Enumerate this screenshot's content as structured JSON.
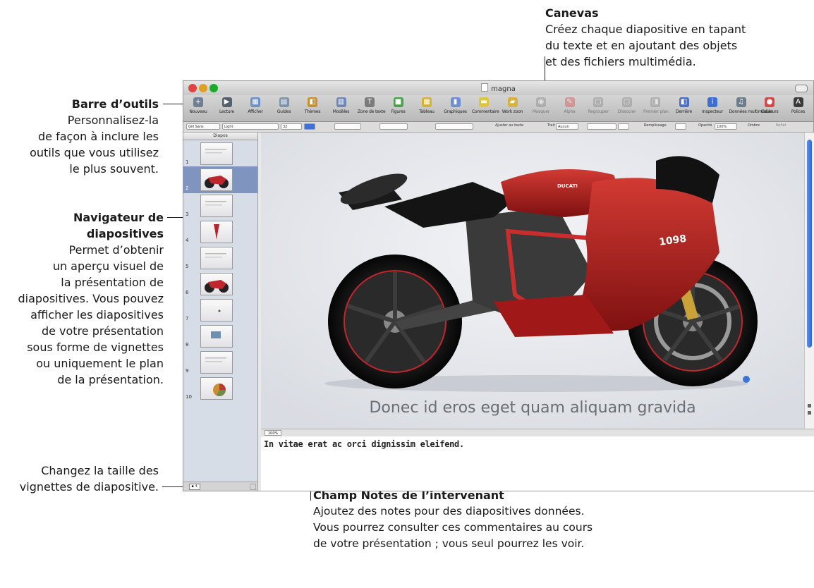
{
  "callouts": {
    "canvas": {
      "title": "Canevas",
      "lines": [
        "Créez chaque diapositive en tapant",
        "du texte et en ajoutant des objets",
        "et des fichiers multimédia."
      ]
    },
    "toolbar": {
      "title": "Barre d’outils",
      "lines": [
        "Personnalisez-la",
        "de façon à inclure les",
        "outils que vous utilisez",
        "le plus souvent."
      ]
    },
    "navigator": {
      "title_lines": [
        "Navigateur de",
        "diapositives"
      ],
      "lines": [
        "Permet d’obtenir",
        "un aperçu visuel de",
        "la présentation de",
        "diapositives. Vous pouvez",
        "afficher les diapositives",
        "de votre présentation",
        "sous forme de vignettes",
        "ou uniquement le plan",
        "de la présentation."
      ]
    },
    "thumb_size": {
      "lines": [
        "Changez la taille des",
        "vignettes de diapositive."
      ]
    },
    "notes": {
      "title": "Champ Notes de l’intervenant",
      "lines": [
        "Ajoutez des notes pour des diapositives données.",
        "Vous pourrez consulter ces commentaires au cours",
        "de votre présentation ; vous seul pourrez les voir."
      ]
    }
  },
  "window": {
    "title": "magna",
    "traffic_colors": [
      "#e0443e",
      "#dea123",
      "#1aab29"
    ]
  },
  "toolbar": [
    {
      "label": "Nouveau",
      "icon": "plus-icon",
      "glyph": "+",
      "color": "#6f7f93"
    },
    {
      "label": "Lecture",
      "icon": "play-icon",
      "glyph": "▶",
      "color": "#55606e"
    },
    {
      "label": "Afficher",
      "icon": "view-icon",
      "glyph": "▦",
      "color": "#6b8fc7"
    },
    {
      "label": "Guides",
      "icon": "guides-icon",
      "glyph": "▤",
      "color": "#7d93ad"
    },
    {
      "label": "Thèmes",
      "icon": "themes-icon",
      "glyph": "◧",
      "color": "#c98f31"
    },
    {
      "label": "Modèles",
      "icon": "masters-icon",
      "glyph": "▥",
      "color": "#6f86b5"
    },
    {
      "label": "Zone de texte",
      "icon": "textbox-icon",
      "glyph": "T",
      "color": "#7b7b7b"
    },
    {
      "label": "Figures",
      "icon": "shapes-icon",
      "glyph": "■",
      "color": "#4aa34a"
    },
    {
      "label": "Tableau",
      "icon": "table-icon",
      "glyph": "▦",
      "color": "#d6b234"
    },
    {
      "label": "Graphiques",
      "icon": "charts-icon",
      "glyph": "▮",
      "color": "#6d8fd6"
    },
    {
      "label": "Commentaire",
      "icon": "comment-icon",
      "glyph": "▬",
      "color": "#e2c53e"
    },
    {
      "label": "Work zoon",
      "icon": "folder-icon",
      "glyph": "▰",
      "color": "#d8b13f"
    },
    {
      "label": "Masquer",
      "icon": "mask-icon",
      "glyph": "◉",
      "color": "#8a8a8a"
    },
    {
      "label": "Alpha",
      "icon": "alpha-icon",
      "glyph": "✎",
      "color": "#d95555"
    },
    {
      "label": "Regrouper",
      "icon": "group-icon",
      "glyph": "▢",
      "color": "#8a8a8a"
    },
    {
      "label": "Dissocier",
      "icon": "ungroup-icon",
      "glyph": "▢",
      "color": "#8a8a8a"
    },
    {
      "label": "Premier plan",
      "icon": "front-icon",
      "glyph": "◨",
      "color": "#8a8a8a"
    },
    {
      "label": "Derrière",
      "icon": "back-icon",
      "glyph": "◧",
      "color": "#4b6fc2"
    },
    {
      "label": "Inspecteur",
      "icon": "inspector-icon",
      "glyph": "i",
      "color": "#3b6fd4"
    },
    {
      "label": "Données multimédias",
      "icon": "media-icon",
      "glyph": "♫",
      "color": "#6d7c8c"
    },
    {
      "label": "Couleurs",
      "icon": "colors-icon",
      "glyph": "●",
      "color": "#d44848"
    },
    {
      "label": "Polices",
      "icon": "fonts-icon",
      "glyph": "A",
      "color": "#3a3a3a"
    }
  ],
  "formatbar": {
    "font_family": "Gill Sans",
    "font_style": "Light",
    "font_size": "32",
    "autosize": "Ajuster au texte",
    "trait_label": "Trait",
    "trait_value": "Aucun",
    "fill_label": "Remplissage",
    "opacity_label": "Opacité",
    "opacity_value": "100%",
    "shadow_label": "Ombre",
    "reflection_label": "Reflet"
  },
  "navigator": {
    "header": "Diapos",
    "slides": [
      {
        "number": "1",
        "selected": false,
        "content": "text"
      },
      {
        "number": "2",
        "selected": true,
        "content": "bike"
      },
      {
        "number": "3",
        "selected": false,
        "content": "text"
      },
      {
        "number": "4",
        "selected": false,
        "content": "redshape"
      },
      {
        "number": "5",
        "selected": false,
        "content": "text"
      },
      {
        "number": "6",
        "selected": false,
        "content": "bike"
      },
      {
        "number": "7",
        "selected": false,
        "content": "dot"
      },
      {
        "number": "8",
        "selected": false,
        "content": "photo"
      },
      {
        "number": "9",
        "selected": false,
        "content": "text"
      },
      {
        "number": "10",
        "selected": false,
        "content": "pie"
      }
    ],
    "thumb_size_control": "▪ ⇕"
  },
  "canvas": {
    "caption": "Donec id eros eget quam aliquam gravida",
    "bike_badge": "1098",
    "brand": "DUCATI"
  },
  "zoom": {
    "value": "100%"
  },
  "notes": {
    "text": "In vitae erat ac orci dignissim eleifend."
  }
}
